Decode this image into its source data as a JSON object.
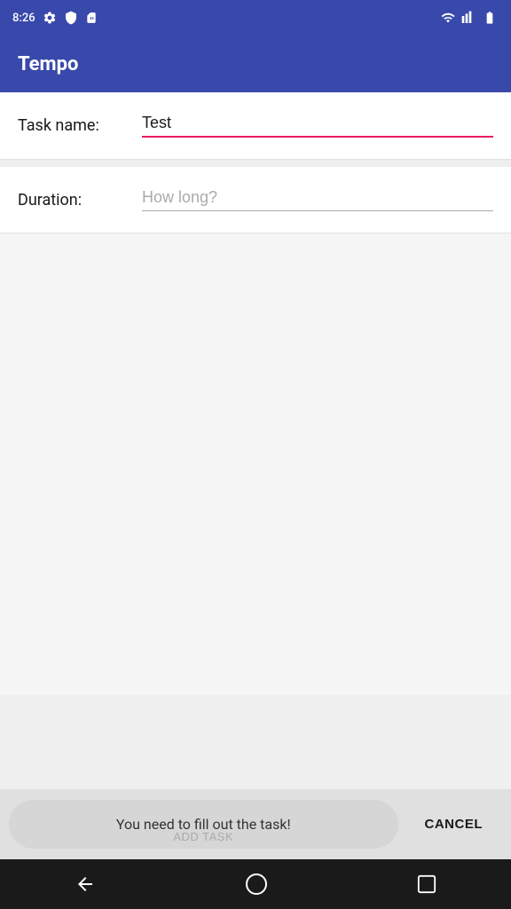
{
  "statusBar": {
    "time": "8:26",
    "wifiLabel": "wifi",
    "signalLabel": "signal",
    "batteryLabel": "battery"
  },
  "header": {
    "title": "Tempo"
  },
  "form": {
    "taskNameLabel": "Task name:",
    "taskNameValue": "Test",
    "taskNamePlaceholder": "",
    "durationLabel": "Duration:",
    "durationValue": "",
    "durationPlaceholder": "How long?"
  },
  "bottomBar": {
    "toastMessage": "You need to fill out the task!",
    "addTaskLabel": "ADD TASK",
    "cancelLabel": "CANCEL"
  },
  "colors": {
    "accent": "#3949AB",
    "pink": "#e91e63"
  }
}
